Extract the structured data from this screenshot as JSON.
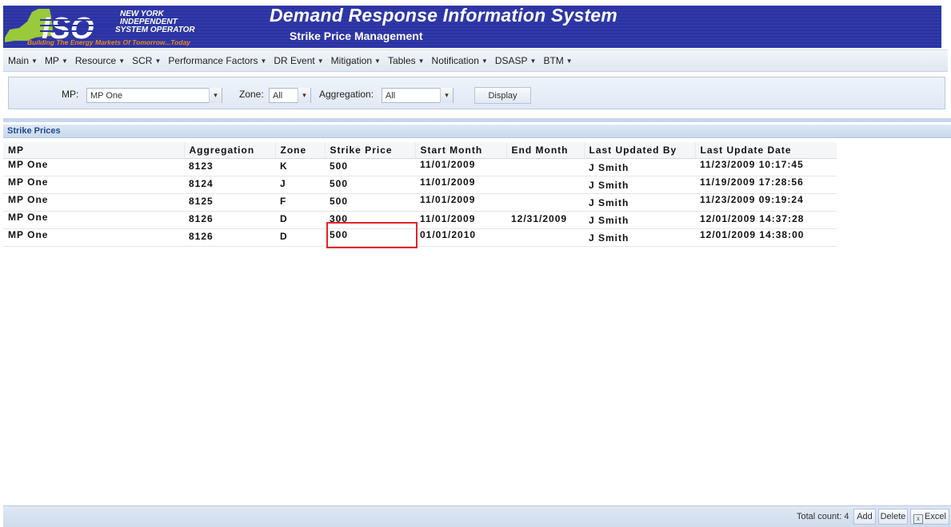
{
  "header": {
    "logo_text": "ISO",
    "logo_line1": "NEW YORK",
    "logo_line2": "INDEPENDENT",
    "logo_line3": "SYSTEM OPERATOR",
    "logo_tagline": "Building The Energy Markets Of Tomorrow...Today",
    "title": "Demand Response Information System",
    "subtitle": "Strike Price Management"
  },
  "menu": [
    "Main",
    "MP",
    "Resource",
    "SCR",
    "Performance Factors",
    "DR Event",
    "Mitigation",
    "Tables",
    "Notification",
    "DSASP",
    "BTM"
  ],
  "filters": {
    "mp_label": "MP:",
    "mp_value": "MP One",
    "zone_label": "Zone:",
    "zone_value": "All",
    "aggregation_label": "Aggregation:",
    "aggregation_value": "All",
    "display_button": "Display"
  },
  "grid": {
    "title": "Strike Prices",
    "columns": [
      "MP",
      "Aggregation",
      "Zone",
      "Strike Price",
      "Start Month",
      "End Month",
      "Last Updated By",
      "Last Update Date"
    ],
    "rows": [
      {
        "mp": "MP One",
        "aggregation": "8123",
        "zone": "K",
        "strike_price": "500",
        "start_month": "11/01/2009",
        "end_month": "",
        "updated_by": "J Smith",
        "update_date": "11/23/2009 10:17:45"
      },
      {
        "mp": "MP One",
        "aggregation": "8124",
        "zone": "J",
        "strike_price": "500",
        "start_month": "11/01/2009",
        "end_month": "",
        "updated_by": "J Smith",
        "update_date": "11/19/2009 17:28:56"
      },
      {
        "mp": "MP One",
        "aggregation": "8125",
        "zone": "F",
        "strike_price": "500",
        "start_month": "11/01/2009",
        "end_month": "",
        "updated_by": "J Smith",
        "update_date": "11/23/2009 09:19:24"
      },
      {
        "mp": "MP One",
        "aggregation": "8126",
        "zone": "D",
        "strike_price": "300",
        "start_month": "11/01/2009",
        "end_month": "12/31/2009",
        "updated_by": "J Smith",
        "update_date": "12/01/2009 14:37:28"
      },
      {
        "mp": "MP One",
        "aggregation": "8126",
        "zone": "D",
        "strike_price": "500",
        "start_month": "01/01/2010",
        "end_month": "",
        "updated_by": "J Smith",
        "update_date": "12/01/2009 14:38:00"
      }
    ]
  },
  "footer": {
    "total_count": "Total count: 4",
    "add_button": "Add",
    "delete_button": "Delete",
    "excel_button": "Excel"
  },
  "colors": {
    "banner": "#2b34a7",
    "logo_green": "#9ac93b",
    "logo_orange": "#e8891b",
    "highlight_box": "#e2242a"
  }
}
